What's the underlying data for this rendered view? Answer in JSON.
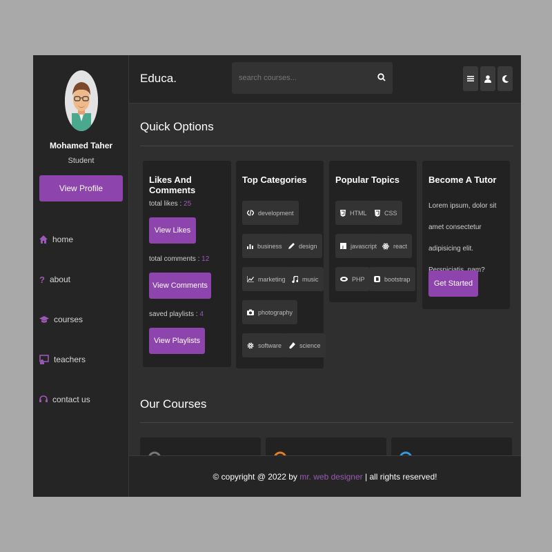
{
  "colors": {
    "accent": "#8e44ad",
    "accent_text": "#9b59b6",
    "panel": "#222222",
    "background": "#2f2f2f"
  },
  "sidebar": {
    "name": "Mohamed Taher",
    "role": "Student",
    "profile_button": "View Profile",
    "nav": [
      {
        "label": "home",
        "icon": "home-icon"
      },
      {
        "label": "about",
        "icon": "question-icon"
      },
      {
        "label": "courses",
        "icon": "graduation-cap-icon"
      },
      {
        "label": "teachers",
        "icon": "chalkboard-teacher-icon"
      },
      {
        "label": "contact us",
        "icon": "headset-icon"
      }
    ]
  },
  "header": {
    "logo": "Educa.",
    "search_placeholder": "search courses...",
    "icons": [
      "menu-icon",
      "user-icon",
      "moon-icon"
    ]
  },
  "main": {
    "quick_options_title": "Quick Options",
    "likes_card": {
      "title": "Likes And Comments",
      "likes_label": "total likes : ",
      "likes_value": "25",
      "likes_button": "View Likes",
      "comments_label": "total comments : ",
      "comments_value": "12",
      "comments_button": "View Comments",
      "playlists_label": "saved playlists : ",
      "playlists_value": "4",
      "playlists_button": "View Playlists"
    },
    "categories_card": {
      "title": "Top Categories",
      "items": [
        {
          "label": "development",
          "icon": "code-icon"
        },
        {
          "label": "business",
          "icon": "bar-chart-icon"
        },
        {
          "label": "design",
          "icon": "pen-icon"
        },
        {
          "label": "marketing",
          "icon": "line-chart-icon"
        },
        {
          "label": "music",
          "icon": "music-icon"
        },
        {
          "label": "photography",
          "icon": "camera-icon"
        },
        {
          "label": "software",
          "icon": "cog-icon"
        },
        {
          "label": "science",
          "icon": "vial-icon"
        }
      ]
    },
    "topics_card": {
      "title": "Popular Topics",
      "items": [
        {
          "label": "HTML",
          "icon": "html5-icon"
        },
        {
          "label": "CSS",
          "icon": "css3-icon"
        },
        {
          "label": "javascript",
          "icon": "js-icon"
        },
        {
          "label": "react",
          "icon": "react-icon"
        },
        {
          "label": "PHP",
          "icon": "php-icon"
        },
        {
          "label": "bootstrap",
          "icon": "bootstrap-icon"
        }
      ]
    },
    "tutor_card": {
      "title": "Become A Tutor",
      "text": "Lorem ipsum, dolor sit amet consectetur adipisicing elit. Perspiciatis, nam?",
      "button": "Get Started"
    },
    "our_courses_title": "Our Courses"
  },
  "footer": {
    "prefix": "© copyright @ 2022 by ",
    "link": "mr. web designer",
    "suffix": " | all rights reserved!"
  }
}
